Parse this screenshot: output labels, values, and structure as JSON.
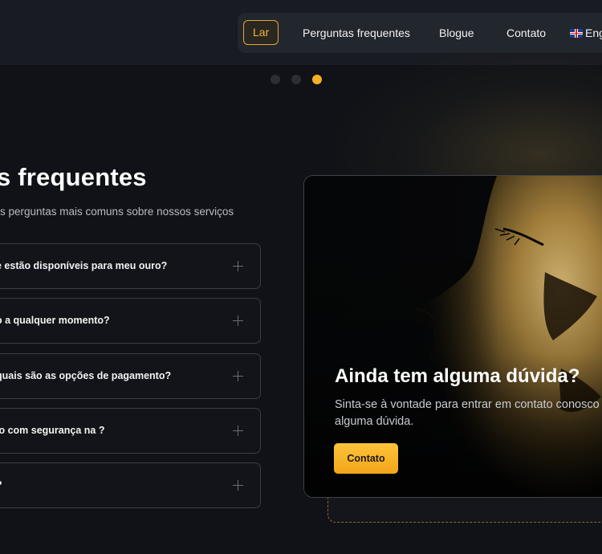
{
  "nav": {
    "items": [
      {
        "label": "Lar"
      },
      {
        "label": "Perguntas frequentes"
      },
      {
        "label": "Blogue"
      },
      {
        "label": "Contato"
      }
    ],
    "language": {
      "label": "Engl",
      "flag": "uk-flag-icon"
    }
  },
  "carousel": {
    "count": 3,
    "active": 3
  },
  "faq": {
    "title": "s frequentes",
    "subtitle": "s perguntas mais comuns sobre nossos serviços",
    "items": [
      {
        "question": "e estão disponíveis para meu ouro?"
      },
      {
        "question": "o a qualquer momento?"
      },
      {
        "question": "quais são as opções de pagamento?"
      },
      {
        "question": "lo com segurança na ?"
      },
      {
        "question": "?"
      }
    ],
    "expand_icon": "plus-icon"
  },
  "contact_card": {
    "title": "Ainda tem alguma dúvida?",
    "text": "Sinta-se à vontade para entrar em contato conosco alguma dúvida.",
    "button_label": "Contato"
  },
  "colors": {
    "background": "#101217",
    "accent": "#f5b123",
    "nav_bg": "#22262d"
  }
}
